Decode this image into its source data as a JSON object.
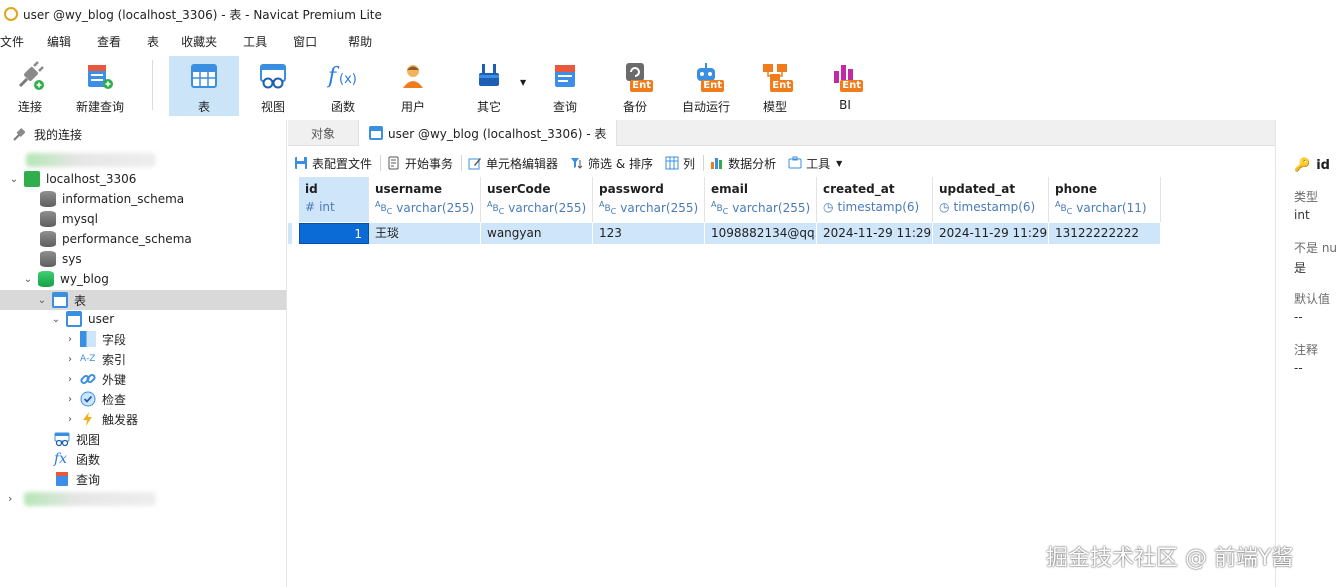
{
  "window": {
    "title": "user @wy_blog (localhost_3306) - 表 - Navicat Premium Lite"
  },
  "menu": [
    "文件",
    "编辑",
    "查看",
    "表",
    "收藏夹",
    "工具",
    "窗口",
    "帮助"
  ],
  "ribbon": {
    "connect": "连接",
    "new_query": "新建查询",
    "table": "表",
    "view": "视图",
    "function": "函数",
    "user": "用户",
    "others": "其它",
    "query": "查询",
    "backup": "备份",
    "automation": "自动运行",
    "model": "模型",
    "bi": "BI",
    "ent_badge": "Ent"
  },
  "tree": {
    "root": "我的连接",
    "connection": "localhost_3306",
    "databases": [
      "information_schema",
      "mysql",
      "performance_schema",
      "sys",
      "wy_blog"
    ],
    "tables_group": "表",
    "table_name": "user",
    "table_children": [
      "字段",
      "索引",
      "外键",
      "检查",
      "触发器"
    ],
    "views": "视图",
    "functions": "函数",
    "queries": "查询"
  },
  "tabs": {
    "objects": "对象",
    "active": "user @wy_blog (localhost_3306) - 表"
  },
  "table_toolbar": {
    "profile": "表配置文件",
    "begin_tx": "开始事务",
    "cell_editor": "单元格编辑器",
    "filter_sort": "筛选 & 排序",
    "columns": "列",
    "analysis": "数据分析",
    "tools": "工具"
  },
  "grid": {
    "columns": [
      {
        "name": "id",
        "type": "int",
        "type_icon": "#"
      },
      {
        "name": "username",
        "type": "varchar(255)",
        "type_icon": "ABC"
      },
      {
        "name": "userCode",
        "type": "varchar(255)",
        "type_icon": "ABC"
      },
      {
        "name": "password",
        "type": "varchar(255)",
        "type_icon": "ABC"
      },
      {
        "name": "email",
        "type": "varchar(255)",
        "type_icon": "ABC"
      },
      {
        "name": "created_at",
        "type": "timestamp(6)",
        "type_icon": "clock"
      },
      {
        "name": "updated_at",
        "type": "timestamp(6)",
        "type_icon": "clock"
      },
      {
        "name": "phone",
        "type": "varchar(11)",
        "type_icon": "ABC"
      }
    ],
    "row": [
      "1",
      "王琰",
      "wangyan",
      "123",
      "1098882134@qq.",
      "2024-11-29 11:29:",
      "2024-11-29 11:29:",
      "13122222222"
    ]
  },
  "right_panel": {
    "field": "id",
    "type_label": "类型",
    "type_value": "int",
    "notnull_label": "不是 nu",
    "notnull_value": "是",
    "default_label": "默认值",
    "default_value": "--",
    "comment_label": "注释",
    "comment_value": "--"
  },
  "watermark": "掘金技术社区 @ 前端Y酱",
  "colors": {
    "selection": "#cce4f7",
    "accent": "#0a6bd6",
    "ent": "#f07c1b"
  }
}
